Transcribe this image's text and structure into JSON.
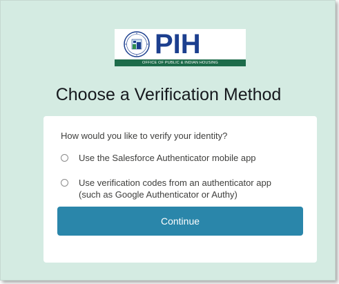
{
  "logo": {
    "wordmark": "PIH",
    "tagline": "OFFICE OF PUBLIC & INDIAN HOUSING"
  },
  "page": {
    "title": "Choose a Verification Method"
  },
  "form": {
    "prompt": "How would you like to verify your identity?",
    "options": [
      {
        "label": "Use the Salesforce Authenticator mobile app",
        "selected": false
      },
      {
        "label_line1": "Use verification codes from an authenticator app",
        "label_line2": "(such as Google Authenticator or Authy)",
        "selected": false
      }
    ],
    "continue_label": "Continue"
  },
  "colors": {
    "background": "#d4ebe2",
    "button": "#2a86aa",
    "logo_blue": "#1c3f8f",
    "logo_band": "#1d6b4a"
  }
}
